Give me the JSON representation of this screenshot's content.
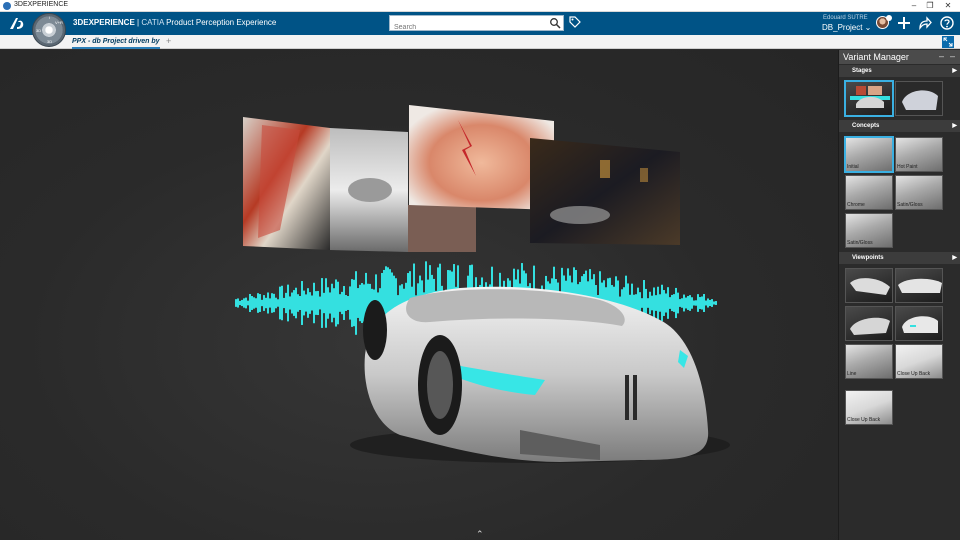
{
  "window": {
    "title": "3DEXPERIENCE",
    "controls": [
      "–",
      "❐",
      "✕"
    ]
  },
  "header": {
    "brand_bold": "3DEXPERIENCE",
    "brand_sep": " | ",
    "brand_app": "CATIA",
    "brand_product": " Product Perception Experience",
    "search_placeholder": "Search",
    "user_name": "Edouard SUTRE",
    "project": "DB_Project ⌄",
    "compass_labels": [
      "3D",
      "V+R",
      "i",
      "3D"
    ],
    "icons": [
      "search-icon",
      "tag-icon",
      "plus-icon",
      "share-icon",
      "help-icon"
    ]
  },
  "tabs": [
    {
      "label": "PPX - db Project driven by",
      "active": true
    }
  ],
  "tab_add_label": "+",
  "viewport": {
    "expand_label": "⌃",
    "accent_color": "#34e0e0"
  },
  "variant_manager": {
    "title": "Variant Manager",
    "minimize": "–",
    "close": "–",
    "sections": {
      "stages": {
        "label": "Stages",
        "arrow": "▶"
      },
      "concepts": {
        "label": "Concepts",
        "arrow": "▶"
      },
      "viewpoints": {
        "label": "Viewpoints",
        "arrow": "▶"
      }
    },
    "stages": [
      {
        "caption": "",
        "selected": true
      },
      {
        "caption": "",
        "selected": false
      }
    ],
    "concepts": [
      {
        "caption": "Initial",
        "selected": true
      },
      {
        "caption": "Hot Paint",
        "selected": false
      },
      {
        "caption": "Chrome",
        "selected": false
      },
      {
        "caption": "Satin/Gloss",
        "selected": false
      },
      {
        "caption": "Satin/Gloss",
        "selected": false
      }
    ],
    "viewpoints": [
      {
        "caption": "",
        "selected": false
      },
      {
        "caption": "",
        "selected": false
      },
      {
        "caption": "",
        "selected": false
      },
      {
        "caption": "",
        "selected": false
      },
      {
        "caption": "Line",
        "selected": false
      },
      {
        "caption": "Close Up Back",
        "selected": false
      },
      {
        "caption": "Close Up Back",
        "selected": false
      }
    ]
  }
}
